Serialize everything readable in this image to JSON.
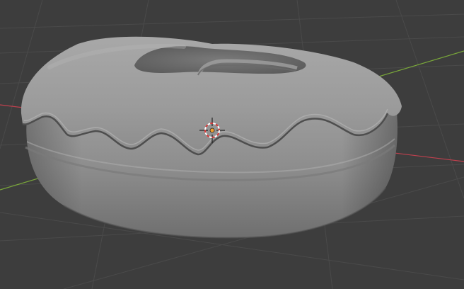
{
  "viewport": {
    "background": "#3d3d3d",
    "grid_color": "#4a4a4a",
    "x_axis_color": "#c0404e",
    "y_axis_color": "#7aa83a",
    "model_color": "#a9a9a9"
  },
  "icons": {
    "cursor": "3d-cursor-icon",
    "origin": "object-origin-icon"
  }
}
